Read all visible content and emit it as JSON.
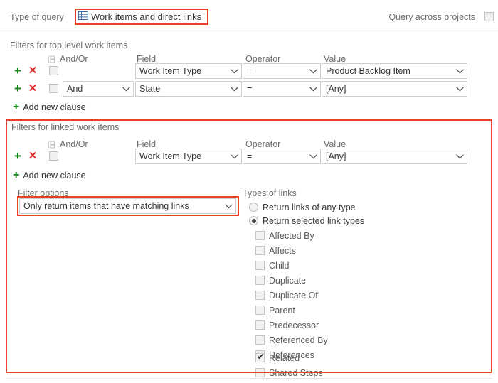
{
  "header": {
    "type_of_query_label": "Type of query",
    "query_type_value": "Work items and direct links",
    "query_type_icon": "grid-icon",
    "query_across_projects_label": "Query across projects",
    "query_across_projects_checked": false
  },
  "top_filters": {
    "title": "Filters for top level work items",
    "columns": {
      "group": "",
      "andor": "And/Or",
      "field": "Field",
      "operator": "Operator",
      "value": "Value"
    },
    "rows": [
      {
        "group_checked": false,
        "andor": "",
        "field": "Work Item Type",
        "operator": "=",
        "value": "Product Backlog Item"
      },
      {
        "group_checked": false,
        "andor": "And",
        "field": "State",
        "operator": "=",
        "value": "[Any]"
      }
    ],
    "add_new_clause": "Add new clause"
  },
  "linked_filters": {
    "title": "Filters for linked work items",
    "columns": {
      "andor": "And/Or",
      "field": "Field",
      "operator": "Operator",
      "value": "Value"
    },
    "rows": [
      {
        "group_checked": false,
        "andor": "",
        "field": "Work Item Type",
        "operator": "=",
        "value": "[Any]"
      }
    ],
    "add_new_clause": "Add new clause"
  },
  "filter_options": {
    "title": "Filter options",
    "value": "Only return items that have matching links"
  },
  "link_types": {
    "title": "Types of links",
    "mode_any_label": "Return links of any type",
    "mode_selected_label": "Return selected link types",
    "mode_selected": true,
    "items": [
      {
        "label": "Affected By",
        "checked": false
      },
      {
        "label": "Affects",
        "checked": false
      },
      {
        "label": "Child",
        "checked": false
      },
      {
        "label": "Duplicate",
        "checked": false
      },
      {
        "label": "Duplicate Of",
        "checked": false
      },
      {
        "label": "Parent",
        "checked": false
      },
      {
        "label": "Predecessor",
        "checked": false
      },
      {
        "label": "Referenced By",
        "checked": false
      },
      {
        "label": "References",
        "checked": false
      },
      {
        "label": "Related",
        "checked": true
      },
      {
        "label": "Shared Steps",
        "checked": false
      }
    ]
  },
  "colors": {
    "highlight": "#E8412A",
    "add": "#107C10",
    "remove": "#E03030"
  }
}
